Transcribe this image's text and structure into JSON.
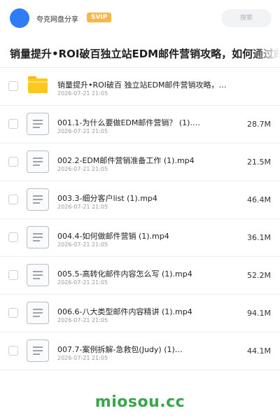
{
  "header": {
    "owner_name": "夸克网盘分享",
    "badge": "SVIP",
    "search_placeholder": "搜索"
  },
  "page": {
    "title": "销量提升•ROI破百独立站EDM邮件营销攻略，如何通过邮件"
  },
  "files": [
    {
      "type": "folder",
      "name": "销量提升•ROI破百 独立站EDM邮件营销攻略，如…",
      "date": "2026-07-21 21:05",
      "size": ""
    },
    {
      "type": "file",
      "name": "001.1-为什么要做EDM邮件营销？ (1).…",
      "date": "2026-07-21 21:05",
      "size": "28.7M"
    },
    {
      "type": "file",
      "name": "002.2-EDM邮件营销准备工作 (1).mp4",
      "date": "2026-07-21 21:05",
      "size": "21.5M"
    },
    {
      "type": "file",
      "name": "003.3-细分客户list (1).mp4",
      "date": "2026-07-21 21:05",
      "size": "46.4M"
    },
    {
      "type": "file",
      "name": "004.4-如何做邮件营销 (1).mp4",
      "date": "2026-07-21 21:05",
      "size": "36.1M"
    },
    {
      "type": "file",
      "name": "005.5-高转化邮件内容怎么写 (1).mp4",
      "date": "2026-07-21 21:05",
      "size": "52.2M"
    },
    {
      "type": "file",
      "name": "006.6-八大类型邮件内容精讲 (1).mp4",
      "date": "2026-07-21 21:05",
      "size": "94.1M"
    },
    {
      "type": "file",
      "name": "007.7-案例拆解-急救包(Judy) (1)…",
      "date": "2026-07-21 21:05",
      "size": "44.1M"
    }
  ],
  "watermark": "miosou.cc",
  "colors": {
    "avatar": "#2e7df6",
    "svip_badge": "#ffb545",
    "folder": "#fcc820",
    "watermark": "#36a84a"
  }
}
